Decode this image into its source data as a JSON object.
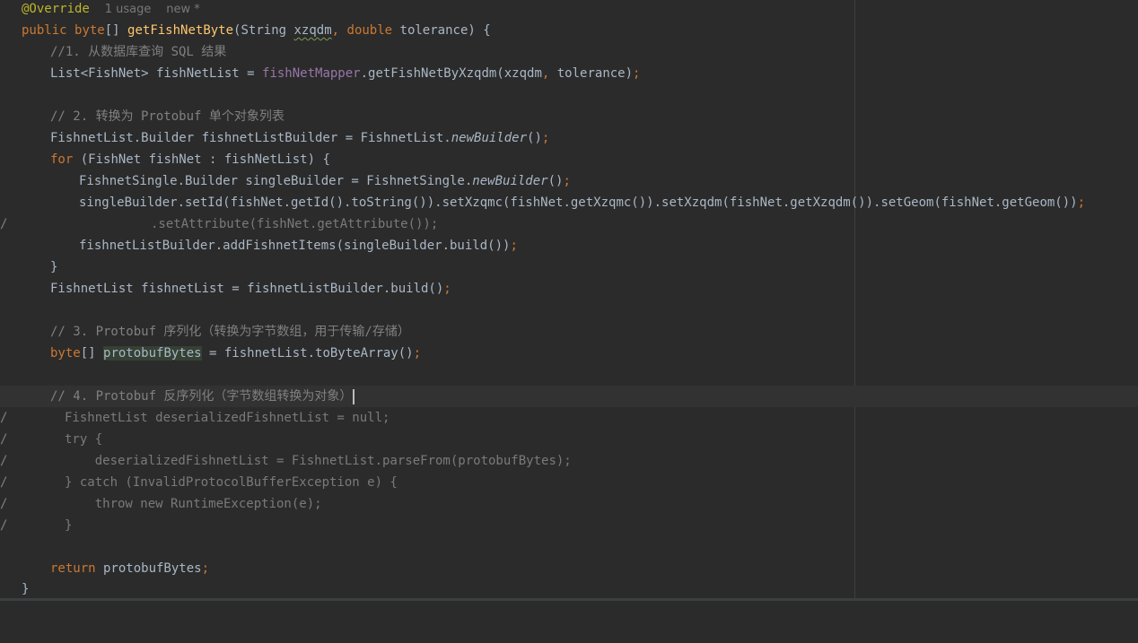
{
  "editor": {
    "annotation": "@Override",
    "hints": {
      "usage": "1 usage",
      "author": "new *"
    },
    "method_sig": {
      "kw_public": "public",
      "kw_byte": "byte",
      "brackets": "[]",
      "name": "getFishNetByte",
      "paren_open": "(String ",
      "param1": "xzqdm",
      "comma": ",",
      "kw_double": "double",
      "param2_rest": " tolerance) {"
    },
    "comment1": "//1. 从数据库查询 SQL 结果",
    "line_list": {
      "start": "List<FishNet> fishNetList = ",
      "field": "fishNetMapper",
      "call": ".getFishNetByXzqdm(xzqdm",
      "comma": ",",
      "rest": " tolerance)",
      "semi": ";"
    },
    "comment2": "// 2. 转换为 Protobuf 单个对象列表",
    "line_builder": {
      "start": "FishnetList.Builder fishnetListBuilder = FishnetList.",
      "method": "newBuilder",
      "end": "()",
      "semi": ";"
    },
    "line_for": {
      "kw": "for",
      "rest": " (FishNet fishNet : fishNetList) {"
    },
    "line_single": {
      "start": "FishnetSingle.Builder singleBuilder = FishnetSingle.",
      "method": "newBuilder",
      "end": "()",
      "semi": ";"
    },
    "line_setid": {
      "text": "singleBuilder.setId(fishNet.getId().toString()).setXzqmc(fishNet.getXzqmc()).setXzqdm(fishNet.getXzqdm()).setGeom(fishNet.getGeom())",
      "semi": ";"
    },
    "line_attr": ".setAttribute(fishNet.getAttribute());",
    "line_add": {
      "text": "fishnetListBuilder.addFishnetItems(singleBuilder.build())",
      "semi": ";"
    },
    "brace_close": "}",
    "line_build": {
      "text": "FishnetList fishnetList = fishnetListBuilder.build()",
      "semi": ";"
    },
    "comment3": "// 3. Protobuf 序列化（转换为字节数组，用于传输/存储）",
    "line_bytes": {
      "kw": "byte",
      "brackets": "[] ",
      "var": "protobufBytes",
      "rest": " = fishnetList.toByteArray()",
      "semi": ";"
    },
    "comment4": "// 4. Protobuf 反序列化（字节数组转换为对象）",
    "commented_block": [
      "FishnetList deserializedFishnetList = null;",
      "try {",
      "    deserializedFishnetList = FishnetList.parseFrom(protobufBytes);",
      "} catch (InvalidProtocolBufferException e) {",
      "    throw new RuntimeException(e);",
      "}"
    ],
    "line_return": {
      "kw": "return",
      "rest": " protobufBytes",
      "semi": ";"
    },
    "method_close": "}",
    "gutter_slash": "/"
  }
}
